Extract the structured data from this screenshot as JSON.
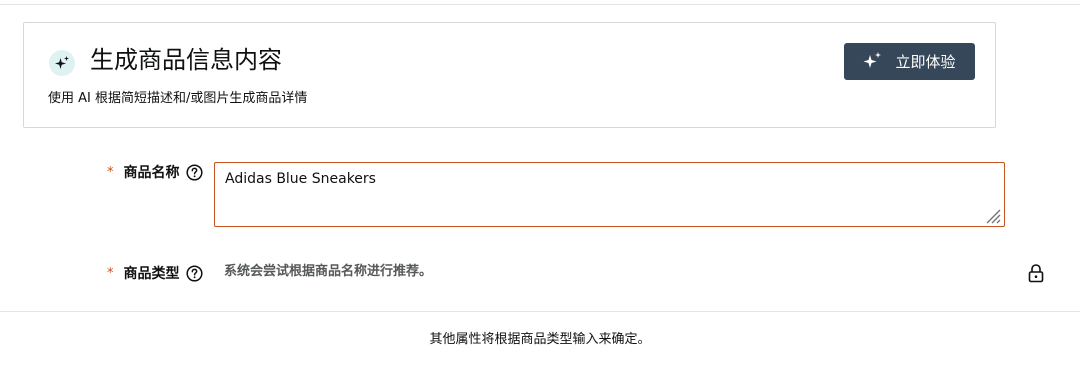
{
  "ai_card": {
    "title": "生成商品信息内容",
    "subtitle": "使用 AI 根据简短描述和/或图片生成商品详情",
    "try_button_label": "立即体验"
  },
  "fields": {
    "required_mark": "*",
    "product_name": {
      "label": "商品名称",
      "value": "Adidas Blue Sneakers"
    },
    "product_type": {
      "label": "商品类型",
      "hint": "系统会尝试根据商品名称进行推荐。"
    }
  },
  "footer_note": "其他属性将根据商品类型输入来确定。",
  "colors": {
    "accent_dark": "#37475a",
    "error_border": "#c7511f",
    "sparkle_bg": "#dff2f3"
  },
  "icons": [
    "sparkle-icon",
    "help-icon",
    "resize-handle-icon",
    "lock-icon"
  ]
}
